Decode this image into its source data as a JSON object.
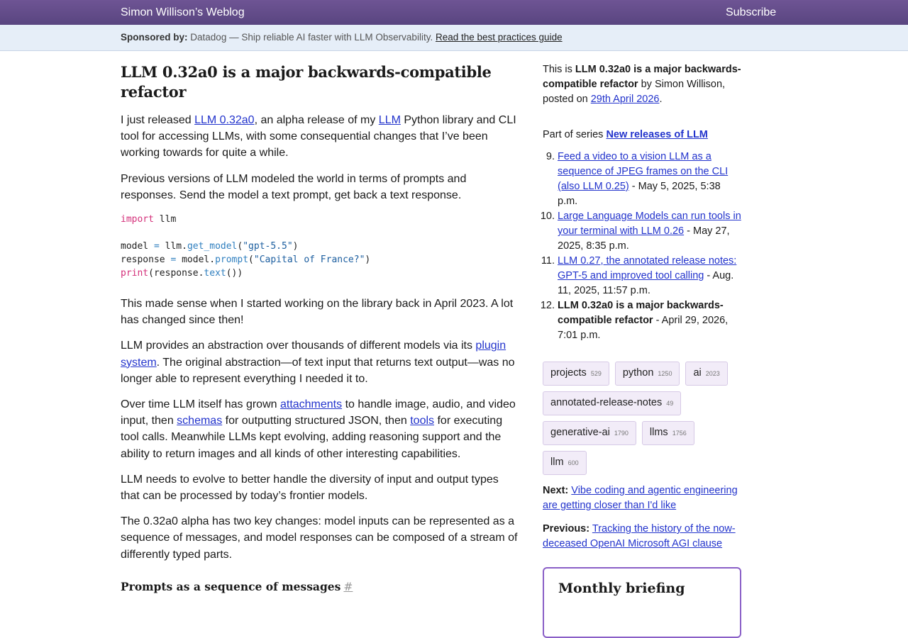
{
  "header": {
    "site_title": "Simon Willison’s Weblog",
    "subscribe": "Subscribe"
  },
  "sponsor": {
    "label": "Sponsored by:",
    "text": "Datadog — Ship reliable AI faster with LLM Observability.",
    "link": "Read the best practices guide"
  },
  "article": {
    "title": "LLM 0.32a0 is a major backwards-compatible refactor",
    "p1": {
      "a": "I just released ",
      "link1": "LLM 0.32a0",
      "b": ", an alpha release of my ",
      "link2": "LLM",
      "c": " Python library and CLI tool for accessing LLMs, with some consequential changes that I’ve been working towards for quite a while."
    },
    "p2": "Previous versions of LLM modeled the world in terms of prompts and responses. Send the model a text prompt, get back a text response.",
    "code": {
      "kw_import": "import",
      "mod": " llm",
      "l2a": "model ",
      "eq": "=",
      "l2b": " llm.",
      "get_model": "get_model",
      "l2c": "(",
      "gpt": "\"gpt-5.5\"",
      "l2d": ")",
      "l3a": "response ",
      "l3b": " model.",
      "prompt": "prompt",
      "l3c": "(",
      "capital": "\"Capital of France?\"",
      "l3d": ")",
      "print": "print",
      "l4a": "(response.",
      "text": "text",
      "l4b": "())"
    },
    "p3": "This made sense when I started working on the library back in April 2023. A lot has changed since then!",
    "p4": {
      "a": "LLM provides an abstraction over thousands of different models via its ",
      "link": "plugin system",
      "b": ". The original abstraction—of text input that returns text output—was no longer able to represent everything I needed it to."
    },
    "p5": {
      "a": "Over time LLM itself has grown ",
      "link1": "attachments",
      "b": " to handle image, audio, and video input, then ",
      "link2": "schemas",
      "c": " for outputting structured JSON, then ",
      "link3": "tools",
      "d": " for executing tool calls. Meanwhile LLMs kept evolving, adding reasoning support and the ability to return images and all kinds of other interesting capabilities."
    },
    "p6": "LLM needs to evolve to better handle the diversity of input and output types that can be processed by today’s frontier models.",
    "p7": "The 0.32a0 alpha has two key changes: model inputs can be represented as a sequence of messages, and model responses can be composed of a stream of differently typed parts.",
    "h2": "Prompts as a sequence of messages",
    "h2_hash": "#"
  },
  "sidebar": {
    "this_is": "This is ",
    "title": "LLM 0.32a0 is a major backwards-compatible refactor",
    "by": " by Simon Willison, posted on ",
    "date": "29th April 2026",
    "period": ".",
    "series_prefix": "Part of series ",
    "series_name": "New releases of LLM",
    "series_items": [
      {
        "link": "Feed a video to a vision LLM as a sequence of JPEG frames on the CLI (also LLM 0.25)",
        "date": " - May 5, 2025, 5:38 p.m."
      },
      {
        "link": "Large Language Models can run tools in your terminal with LLM 0.26",
        "date": " - May 27, 2025, 8:35 p.m."
      },
      {
        "link": "LLM 0.27, the annotated release notes: GPT-5 and improved tool calling",
        "date": " - Aug. 11, 2025, 11:57 p.m."
      },
      {
        "link": "LLM 0.32a0 is a major backwards-compatible refactor",
        "date": " - April 29, 2026, 7:01 p.m."
      }
    ],
    "tags": [
      {
        "name": "projects",
        "count": "529"
      },
      {
        "name": "python",
        "count": "1250"
      },
      {
        "name": "ai",
        "count": "2023"
      },
      {
        "name": "annotated-release-notes",
        "count": "49"
      },
      {
        "name": "generative-ai",
        "count": "1790"
      },
      {
        "name": "llms",
        "count": "1756"
      },
      {
        "name": "llm",
        "count": "600"
      }
    ],
    "next_label": "Next:",
    "next_link": "Vibe coding and agentic engineering are getting closer than I'd like",
    "prev_label": "Previous:",
    "prev_link": "Tracking the history of the now-deceased OpenAI Microsoft AGI clause",
    "briefing_title": "Monthly briefing"
  }
}
